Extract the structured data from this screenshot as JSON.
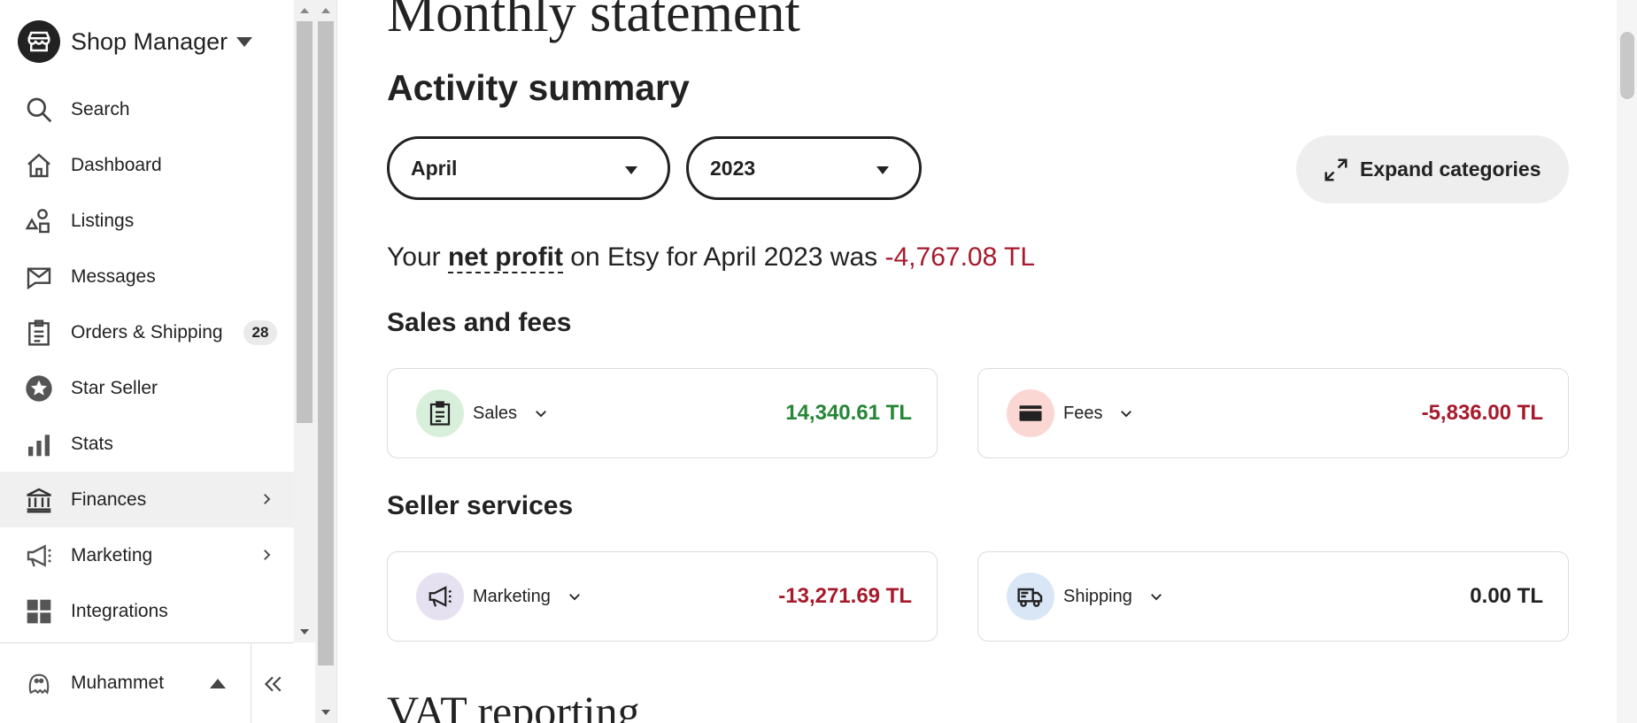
{
  "sidebar": {
    "brand": "Shop Manager",
    "items": [
      {
        "label": "Search"
      },
      {
        "label": "Dashboard"
      },
      {
        "label": "Listings"
      },
      {
        "label": "Messages"
      },
      {
        "label": "Orders & Shipping",
        "badge": "28"
      },
      {
        "label": "Star Seller"
      },
      {
        "label": "Stats"
      },
      {
        "label": "Finances"
      },
      {
        "label": "Marketing"
      },
      {
        "label": "Integrations"
      }
    ],
    "user": "Muhammet"
  },
  "main": {
    "page_title": "Monthly statement",
    "activity_heading": "Activity summary",
    "month": "April",
    "year": "2023",
    "expand_label": "Expand categories",
    "profit": {
      "prefix": "Your",
      "term": "net profit",
      "middle": "on Etsy for April 2023 was",
      "value": "-4,767.08 TL"
    },
    "sales_fees_heading": "Sales and fees",
    "seller_services_heading": "Seller services",
    "cards": {
      "sales": {
        "label": "Sales",
        "value": "14,340.61 TL"
      },
      "fees": {
        "label": "Fees",
        "value": "-5,836.00 TL"
      },
      "marketing": {
        "label": "Marketing",
        "value": "-13,271.69 TL"
      },
      "shipping": {
        "label": "Shipping",
        "value": "0.00 TL"
      }
    },
    "vat_heading": "VAT reporting"
  },
  "colors": {
    "positive": "#258635",
    "negative": "#a61a2c",
    "sales_icon_bg": "#d8efdc",
    "fees_icon_bg": "#fbd7d4",
    "marketing_icon_bg": "#e6e1f1",
    "shipping_icon_bg": "#d9e6f6"
  }
}
